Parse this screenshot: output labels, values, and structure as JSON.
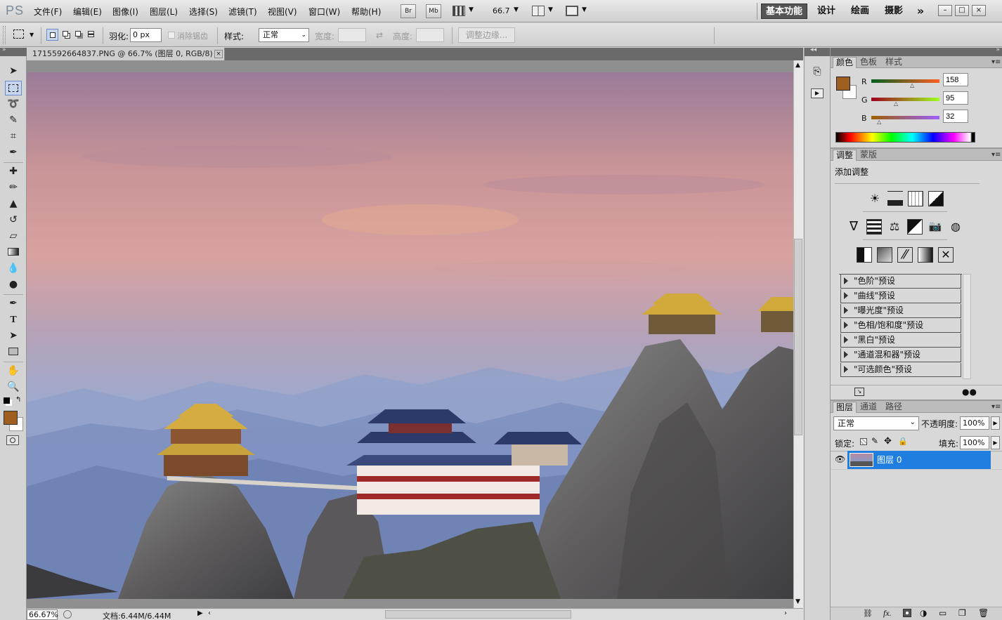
{
  "app": {
    "logo": "PS"
  },
  "menu": [
    "文件(F)",
    "编辑(E)",
    "图像(I)",
    "图层(L)",
    "选择(S)",
    "滤镜(T)",
    "视图(V)",
    "窗口(W)",
    "帮助(H)"
  ],
  "appbar": {
    "br": "Br",
    "mb": "Mb",
    "zoom": "66.7"
  },
  "workspaces": [
    "基本功能",
    "设计",
    "绘画",
    "摄影"
  ],
  "workspace_more": "»",
  "options": {
    "feather_label": "羽化:",
    "feather_value": "0 px",
    "antialias_label": "消除锯齿",
    "style_label": "样式:",
    "style_value": "正常",
    "width_label": "宽度:",
    "height_label": "高度:",
    "refine_edge": "调整边缘..."
  },
  "document": {
    "tab_title": "1715592664837.PNG @ 66.7% (图层 0, RGB/8)",
    "close": "×",
    "zoom_status": "66.67%",
    "doc_size": "文档:6.44M/6.44M"
  },
  "color_panel": {
    "tabs": [
      "颜色",
      "色板",
      "样式"
    ],
    "r_label": "R",
    "g_label": "G",
    "b_label": "B",
    "r": "158",
    "g": "95",
    "b": "32",
    "foreground_color": "#9e5f20"
  },
  "adjustments_panel": {
    "tabs": [
      "调整",
      "蒙版"
    ],
    "title": "添加调整",
    "presets": [
      "\"色阶\"预设",
      "\"曲线\"预设",
      "\"曝光度\"预设",
      "\"色相/饱和度\"预设",
      "\"黑白\"预设",
      "\"通道混和器\"预设",
      "\"可选颜色\"预设"
    ]
  },
  "layers_panel": {
    "tabs": [
      "图层",
      "通道",
      "路径"
    ],
    "blend_mode": "正常",
    "opacity_label": "不透明度:",
    "opacity": "100%",
    "lock_label": "锁定:",
    "fill_label": "填充:",
    "fill": "100%",
    "layers": [
      {
        "name": "图层 0",
        "visible": true,
        "selected": true
      }
    ]
  }
}
